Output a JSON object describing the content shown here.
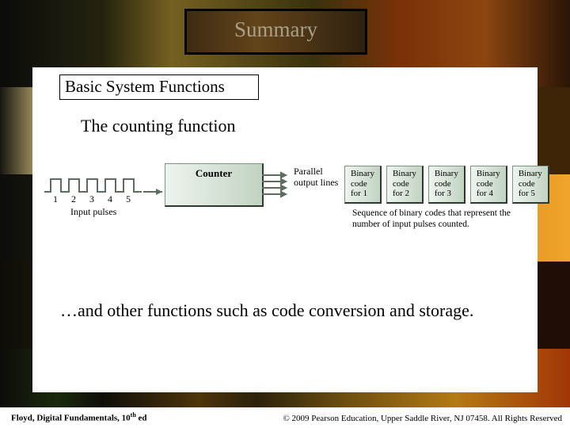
{
  "title": "Summary",
  "section": "Basic System Functions",
  "subtitle": "The counting function",
  "diagram": {
    "counter_label": "Counter",
    "input_pulses_caption": "Input pulses",
    "pulse_numbers": [
      "1",
      "2",
      "3",
      "4",
      "5"
    ],
    "parallel_label_l1": "Parallel",
    "parallel_label_l2": "output lines",
    "codes": [
      {
        "l1": "Binary",
        "l2": "code",
        "l3": "for 1"
      },
      {
        "l1": "Binary",
        "l2": "code",
        "l3": "for 2"
      },
      {
        "l1": "Binary",
        "l2": "code",
        "l3": "for 3"
      },
      {
        "l1": "Binary",
        "l2": "code",
        "l3": "for 4"
      },
      {
        "l1": "Binary",
        "l2": "code",
        "l3": "for 5"
      }
    ],
    "sequence_caption": "Sequence of binary codes that represent the number of input pulses counted."
  },
  "more_text": "…and other functions such as code conversion and storage.",
  "footer": {
    "credit_author": "Floyd, Digital Fundamentals, 10",
    "credit_suffix": "th",
    "credit_tail": " ed",
    "copyright": "© 2009 Pearson Education, Upper Saddle River, NJ 07458. All Rights Reserved"
  }
}
